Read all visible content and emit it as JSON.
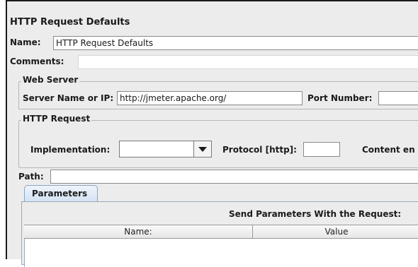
{
  "panel": {
    "title": "HTTP Request Defaults"
  },
  "name": {
    "label": "Name:",
    "value": "HTTP Request Defaults"
  },
  "comments": {
    "label": "Comments:",
    "value": ""
  },
  "web_server": {
    "legend": "Web Server",
    "server_label": "Server Name or IP:",
    "server_value": "http://jmeter.apache.org/",
    "port_label": "Port Number:",
    "port_value": ""
  },
  "http_request": {
    "legend": "HTTP Request",
    "implementation_label": "Implementation:",
    "implementation_value": "",
    "protocol_label": "Protocol [http]:",
    "protocol_value": "",
    "content_label": "Content en"
  },
  "path": {
    "label": "Path:",
    "value": ""
  },
  "tabs": [
    {
      "label": "Parameters",
      "selected": true
    }
  ],
  "parameters": {
    "heading": "Send Parameters With the Request:",
    "columns": [
      "Name:",
      "Value"
    ],
    "rows": []
  },
  "icons": {
    "combo_arrow": "chevron-down-icon"
  }
}
